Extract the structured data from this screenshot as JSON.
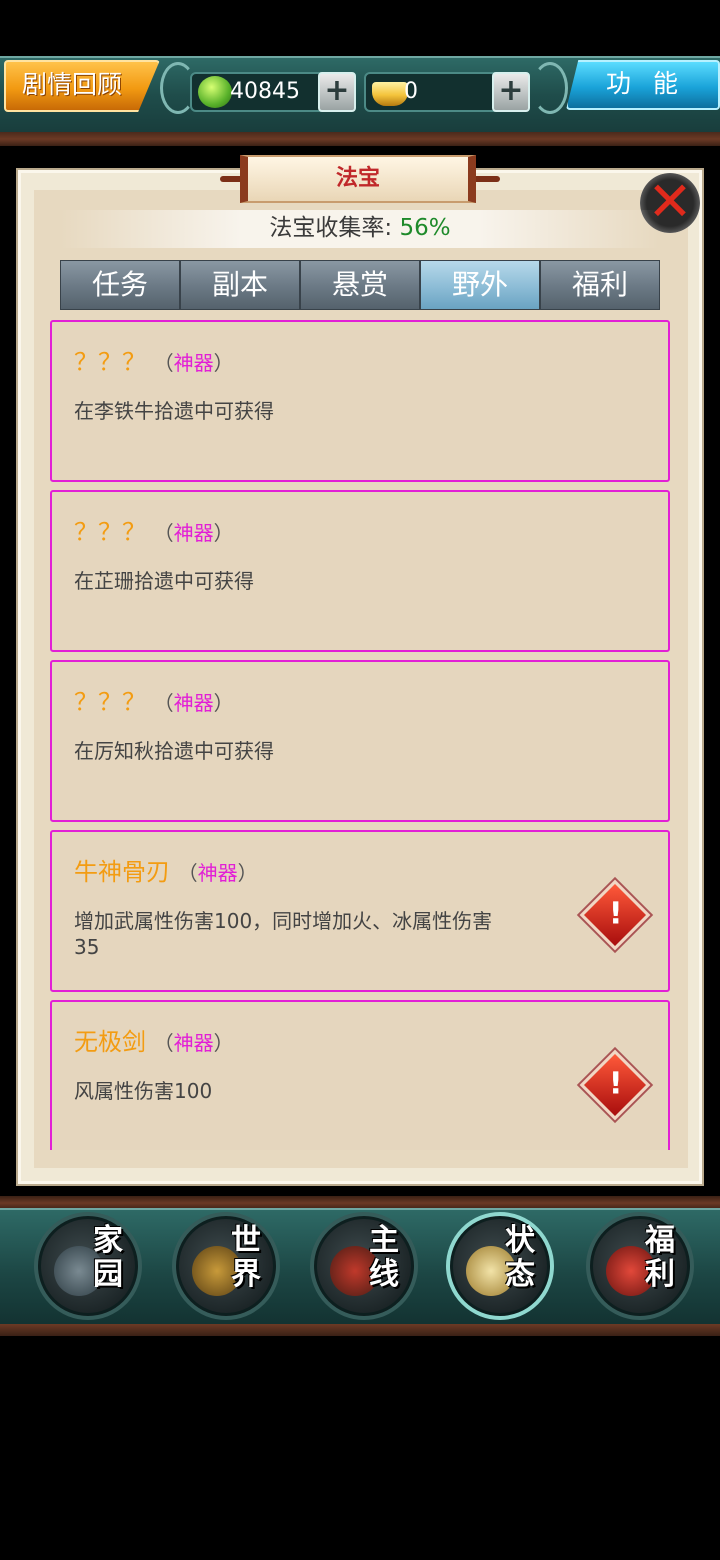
{
  "topbar": {
    "story_label": "剧情回顾",
    "jade_value": "40845",
    "gold_value": "0",
    "plus_label": "+",
    "function_label": "功能"
  },
  "panel": {
    "title": "法宝",
    "collect_label": "法宝收集率:",
    "collect_pct": "56%",
    "close_label": "✕"
  },
  "tabs": [
    "任务",
    "副本",
    "悬赏",
    "野外",
    "福利"
  ],
  "active_tab": "野外",
  "items": [
    {
      "name": "？？？",
      "type": "神器",
      "desc": "在李铁牛拾遗中可获得",
      "warn": false
    },
    {
      "name": "？？？",
      "type": "神器",
      "desc": "在芷珊拾遗中可获得",
      "warn": false
    },
    {
      "name": "？？？",
      "type": "神器",
      "desc": "在厉知秋拾遗中可获得",
      "warn": false
    },
    {
      "name": "牛神骨刃",
      "type": "神器",
      "desc": "增加武属性伤害100，同时增加火、冰属性伤害35",
      "warn": true
    },
    {
      "name": "无极剑",
      "type": "神器",
      "desc": "风属性伤害100",
      "warn": true
    }
  ],
  "paren_open": "（",
  "paren_close": "）",
  "warn_glyph": "!",
  "bottom_nav": [
    {
      "label": "家园",
      "icon": "home-icon"
    },
    {
      "label": "世界",
      "icon": "world-map-icon"
    },
    {
      "label": "主线",
      "icon": "main-quest-icon"
    },
    {
      "label": "状态",
      "icon": "bagua-status-icon"
    },
    {
      "label": "福利",
      "icon": "gift-bag-icon"
    }
  ]
}
